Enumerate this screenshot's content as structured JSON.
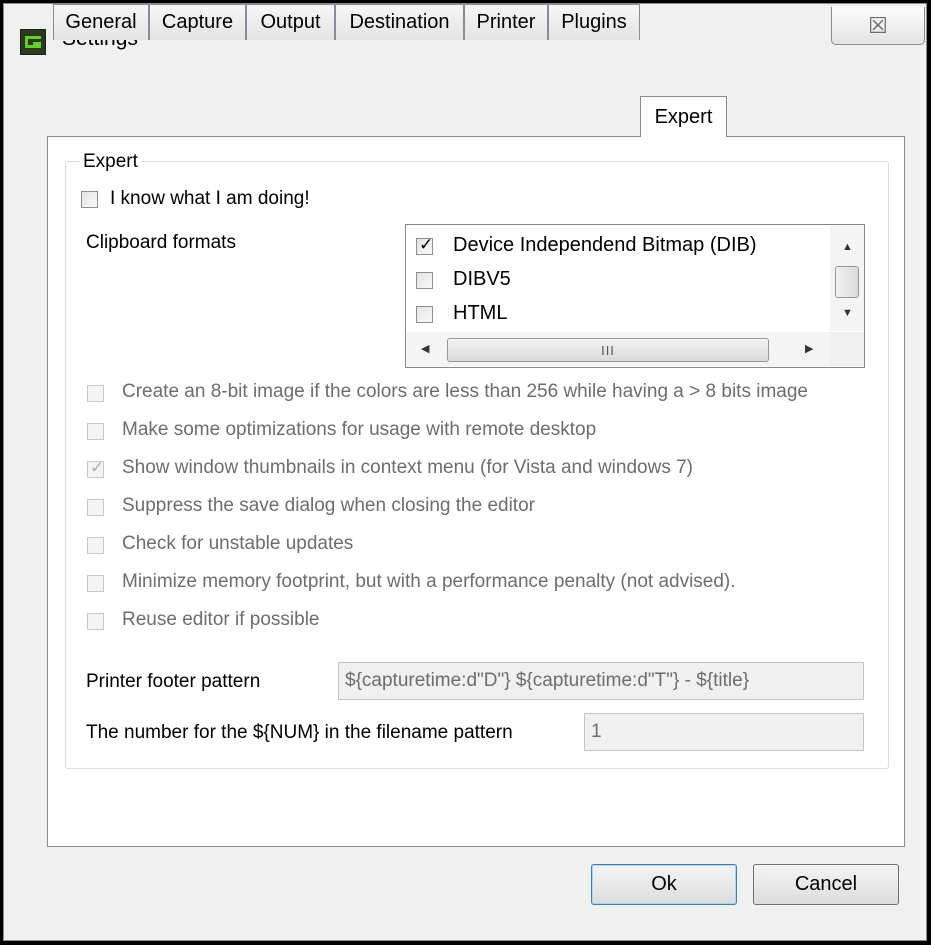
{
  "window": {
    "title": "Settings",
    "close_glyph": "☒"
  },
  "tabs": [
    {
      "label": "General"
    },
    {
      "label": "Capture"
    },
    {
      "label": "Output"
    },
    {
      "label": "Destination"
    },
    {
      "label": "Printer"
    },
    {
      "label": "Plugins"
    },
    {
      "label": "Expert",
      "active": true
    }
  ],
  "expert": {
    "group_label": "Expert",
    "know_what_doing": {
      "label": "I know what I am doing!",
      "checked": false
    },
    "clipboard_formats_label": "Clipboard formats",
    "clipboard_formats": [
      {
        "label": "Device Independend Bitmap (DIB)",
        "checked": true
      },
      {
        "label": "DIBV5",
        "checked": false
      },
      {
        "label": "HTML",
        "checked": false
      }
    ],
    "scroll_thumb_grip": "III",
    "options": [
      {
        "label": "Create an 8-bit image if the colors are less than 256 while having a > 8 bits image",
        "checked": false
      },
      {
        "label": "Make some optimizations for usage with remote desktop",
        "checked": false
      },
      {
        "label": "Show window thumbnails in context menu (for Vista and windows 7)",
        "checked": true
      },
      {
        "label": "Suppress the save dialog when closing the editor",
        "checked": false
      },
      {
        "label": "Check for unstable updates",
        "checked": false
      },
      {
        "label": "Minimize memory footprint, but with a performance penalty (not advised).",
        "checked": false
      },
      {
        "label": "Reuse editor if possible",
        "checked": false
      }
    ],
    "printer_footer_label": "Printer footer pattern",
    "printer_footer_value": "${capturetime:d\"D\"} ${capturetime:d\"T\"} - ${title}",
    "num_label": "The number for the ${NUM} in the filename pattern",
    "num_value": "1"
  },
  "buttons": {
    "ok": "Ok",
    "cancel": "Cancel"
  }
}
